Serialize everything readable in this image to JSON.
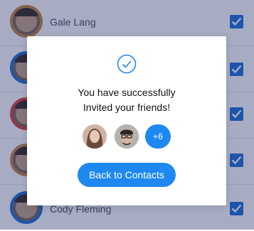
{
  "contacts": [
    {
      "name": "Gale Lang",
      "checked": true,
      "ring_color": "#c58a3e"
    },
    {
      "name": "",
      "checked": true,
      "ring_color": "#1e73d8"
    },
    {
      "name": "",
      "checked": true,
      "ring_color": "#d9443c"
    },
    {
      "name": "",
      "checked": true,
      "ring_color": "#c58a3e"
    },
    {
      "name": "Cody Fleming",
      "checked": true,
      "ring_color": "#1e73d8"
    }
  ],
  "modal": {
    "message_line1": "You have successfully",
    "message_line2": "Invited your friends!",
    "more_count": "+6",
    "back_button_label": "Back to Contacts"
  },
  "colors": {
    "accent": "#1e88f0",
    "checkbox": "#1e73d8",
    "overlay": "rgba(26, 36, 96, 0.38)"
  },
  "icons": {
    "success": "check-circle-icon",
    "checkbox": "checkmark-icon"
  }
}
